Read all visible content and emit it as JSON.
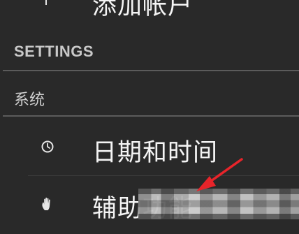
{
  "add_account": {
    "icon": "plus-icon",
    "label": "添加帐户"
  },
  "settings_section": {
    "header": "SETTINGS",
    "category": "系统",
    "items": [
      {
        "icon": "clock-icon",
        "label": "日期和时间"
      },
      {
        "icon": "hand-icon",
        "label": "辅助功能"
      }
    ]
  },
  "annotation": {
    "arrow_color": "#e8242a"
  }
}
